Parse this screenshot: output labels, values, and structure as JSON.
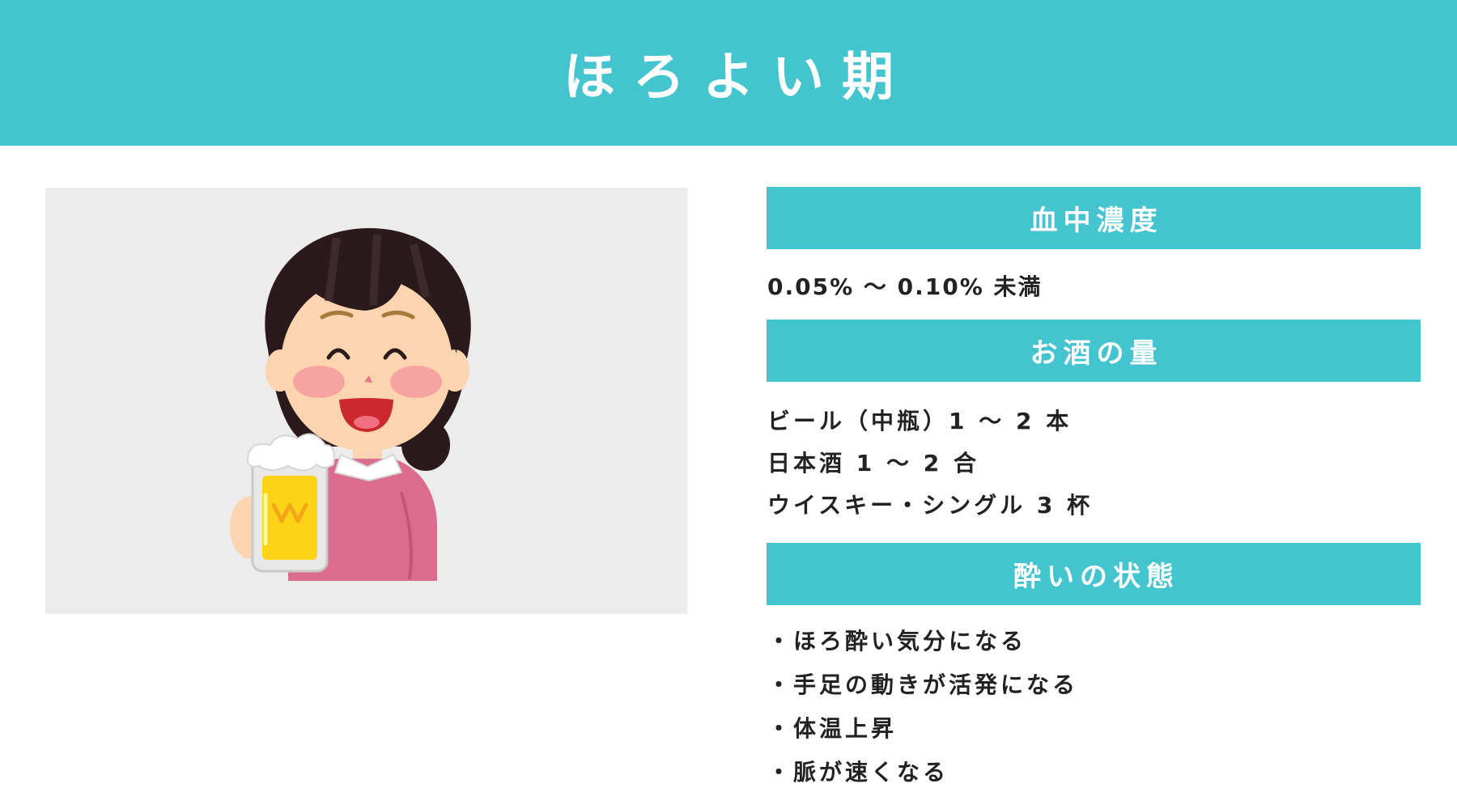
{
  "header": {
    "title": "ほろよい期"
  },
  "illustration": {
    "icon": "woman-holding-beer-mug-illustration",
    "colors": {
      "panel": "#ececec",
      "hair": "#2a1a1c",
      "skin": "#fdd4b0",
      "cheek": "#f49aa0",
      "sweater": "#dc6c8e",
      "beer": "#fdd318",
      "foam": "#ffffff"
    }
  },
  "sections": {
    "concentration": {
      "title": "血中濃度",
      "text": "0.05% 〜 0.10% 未満"
    },
    "amount": {
      "title": "お酒の量",
      "items": [
        "ビール（中瓶）1 〜 2 本",
        "日本酒 1 〜 2 合",
        "ウイスキー・シングル 3 杯"
      ]
    },
    "state": {
      "title": "酔いの状態",
      "items": [
        "・ほろ酔い気分になる",
        "・手足の動きが活発になる",
        "・体温上昇",
        "・脈が速くなる"
      ]
    }
  },
  "colors": {
    "accent": "#44c4cf",
    "text": "#222222",
    "background": "#ffffff"
  }
}
